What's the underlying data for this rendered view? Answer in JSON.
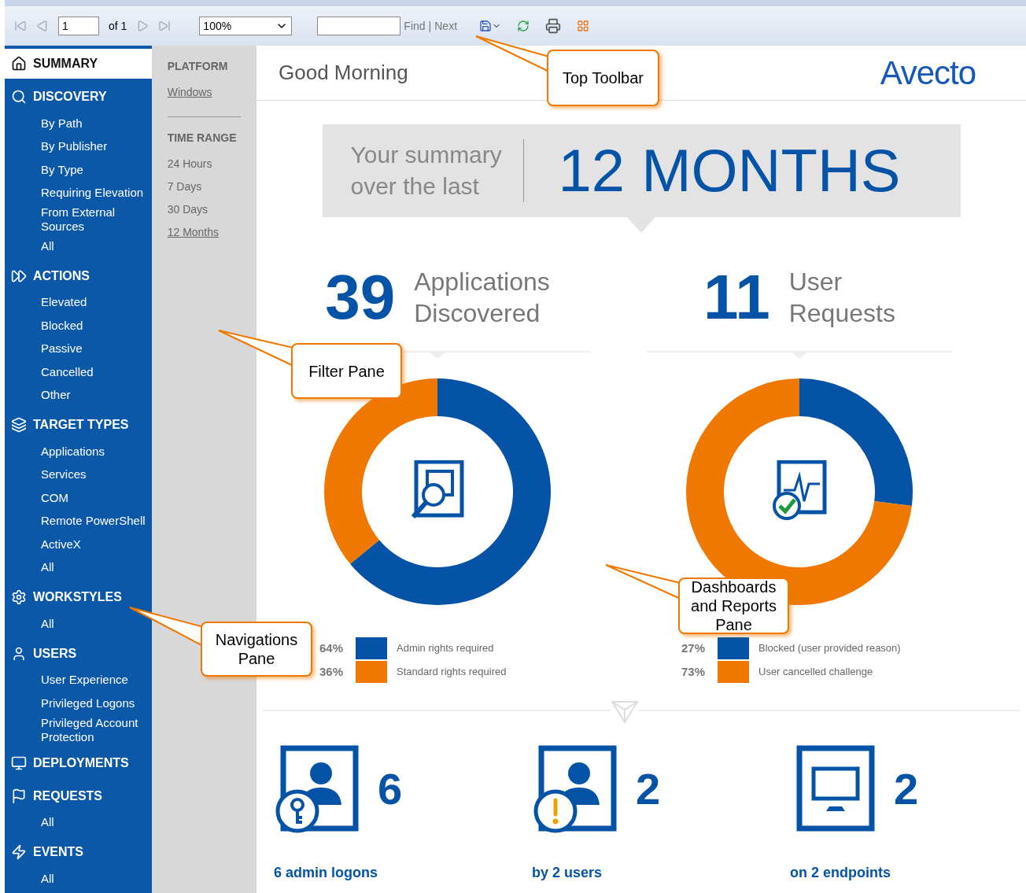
{
  "toolbar": {
    "page": "1",
    "page_count": "of 1",
    "zoom": "100%",
    "find_label": "Find",
    "separator": "|",
    "next_label": "Next"
  },
  "nav": [
    {
      "title": "SUMMARY",
      "selected": true
    },
    {
      "title": "DISCOVERY",
      "selected": false,
      "items": [
        "By Path",
        "By Publisher",
        "By Type",
        "Requiring Elevation",
        "From External Sources",
        "All"
      ]
    },
    {
      "title": "ACTIONS",
      "selected": false,
      "items": [
        "Elevated",
        "Blocked",
        "Passive",
        "Cancelled",
        "Other"
      ]
    },
    {
      "title": "TARGET TYPES",
      "selected": false,
      "items": [
        "Applications",
        "Services",
        "COM",
        "Remote PowerShell",
        "ActiveX",
        "All"
      ]
    },
    {
      "title": "WORKSTYLES",
      "selected": false,
      "items": [
        "All"
      ]
    },
    {
      "title": "USERS",
      "selected": false,
      "items": [
        "User Experience",
        "Privileged Logons",
        "Privileged Account Protection"
      ]
    },
    {
      "title": "DEPLOYMENTS",
      "selected": false
    },
    {
      "title": "REQUESTS",
      "selected": false,
      "items": [
        "All"
      ]
    },
    {
      "title": "EVENTS",
      "selected": false,
      "items": [
        "All"
      ]
    }
  ],
  "filters": [
    {
      "title": "PLATFORM",
      "options": [
        {
          "label": "Windows",
          "selected": true
        }
      ]
    },
    {
      "title": "TIME RANGE",
      "options": [
        {
          "label": "24 Hours",
          "selected": false
        },
        {
          "label": "7 Days",
          "selected": false
        },
        {
          "label": "30 Days",
          "selected": false
        },
        {
          "label": "12 Months",
          "selected": true
        }
      ]
    }
  ],
  "header": {
    "greeting": "Good Morning",
    "logo": "Avecto"
  },
  "summary": {
    "lead": "Your summary over the last",
    "period": "12 MONTHS"
  },
  "stats": [
    {
      "count": "39",
      "label": "Applications Discovered",
      "chart_data": {
        "type": "donut",
        "values": [
          64,
          36
        ]
      },
      "legend": [
        {
          "percent": "64%",
          "label": "Admin rights required",
          "color": "#0553a6"
        },
        {
          "percent": "36%",
          "label": "Standard rights required",
          "color": "#f07800"
        }
      ]
    },
    {
      "count": "11",
      "label": "User Requests",
      "chart_data": {
        "type": "donut",
        "values": [
          27,
          73
        ]
      },
      "legend": [
        {
          "percent": "27%",
          "label": "Blocked (user provided reason)",
          "color": "#0553a6"
        },
        {
          "percent": "73%",
          "label": "User cancelled challenge",
          "color": "#f07800"
        }
      ]
    }
  ],
  "cards": [
    {
      "count": "6",
      "caption": "6 admin logons"
    },
    {
      "count": "2",
      "caption": "by 2 users"
    },
    {
      "count": "2",
      "caption": "on 2 endpoints"
    }
  ],
  "callouts": [
    {
      "text": "Top Toolbar"
    },
    {
      "text": "Filter Pane"
    },
    {
      "text": "Navigations Pane"
    },
    {
      "text": "Dashboards and Reports Pane"
    }
  ]
}
